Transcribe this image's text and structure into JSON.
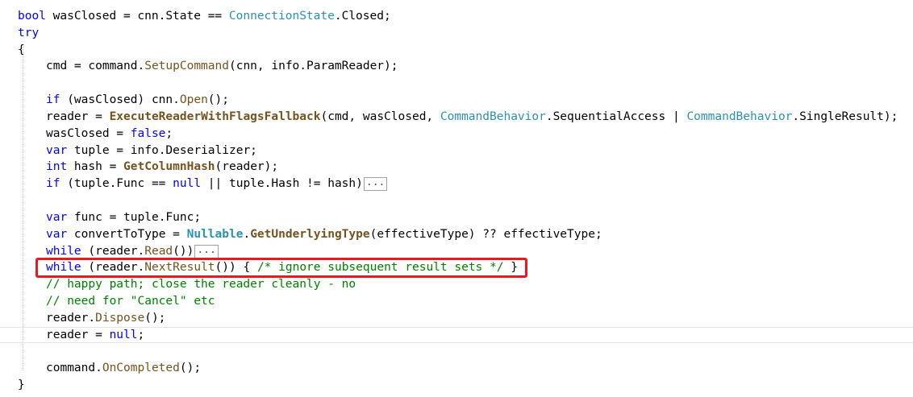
{
  "colors": {
    "keyword": "#0000ff",
    "type": "#2b91af",
    "comment": "#008000",
    "highlight": "#e31b23"
  },
  "code": {
    "l1": {
      "a": "bool",
      "b": " wasClosed = cnn.State == ",
      "c": "ConnectionState",
      "d": ".Closed;"
    },
    "l2": "try",
    "l3": "{",
    "l4": {
      "a": "cmd = command.",
      "b": "SetupCommand",
      "c": "(cnn, info.ParamReader);"
    },
    "l5": {
      "a": "if",
      "b": " (wasClosed) cnn.",
      "c": "Open",
      "d": "();"
    },
    "l6": {
      "a": "reader = ",
      "b": "ExecuteReaderWithFlagsFallback",
      "c": "(cmd, wasClosed, ",
      "d": "CommandBehavior",
      "e": ".SequentialAccess | ",
      "f": "CommandBehavior",
      "g": ".SingleResult);"
    },
    "l7": {
      "a": "wasClosed = ",
      "b": "false",
      "c": ";"
    },
    "l8": {
      "a": "var",
      "b": " tuple = info.Deserializer;"
    },
    "l9": {
      "a": "int",
      "b": " hash = ",
      "c": "GetColumnHash",
      "d": "(reader);"
    },
    "l10": {
      "a": "if",
      "b": " (tuple.Func == ",
      "c": "null",
      "d": " || tuple.Hash != hash)",
      "e": "..."
    },
    "l11": {
      "a": "var",
      "b": " func = tuple.Func;"
    },
    "l12": {
      "a": "var",
      "b": " convertToType = ",
      "c": "Nullable",
      "d": ".",
      "e": "GetUnderlyingType",
      "f": "(effectiveType) ?? effectiveType;"
    },
    "l13": {
      "a": "while",
      "b": " (reader.",
      "c": "Read",
      "d": "())",
      "e": "..."
    },
    "l14": {
      "a": "while",
      "b": " (reader.",
      "c": "NextResult",
      "d": "()) { ",
      "e": "/* ignore subsequent result sets */",
      "f": " }"
    },
    "l15": "// happy path; close the reader cleanly - no",
    "l16": "// need for \"Cancel\" etc",
    "l17": {
      "a": "reader.",
      "b": "Dispose",
      "c": "();"
    },
    "l18": {
      "a": "reader = ",
      "b": "null",
      "c": ";"
    },
    "l19": {
      "a": "command.",
      "b": "OnCompleted",
      "c": "();"
    },
    "l20": "}"
  }
}
